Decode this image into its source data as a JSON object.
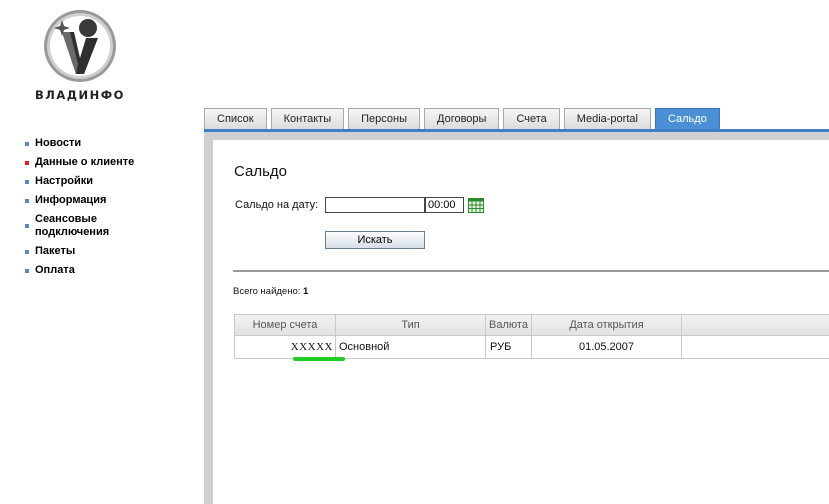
{
  "brand": {
    "name": "ВЛАДИНФО"
  },
  "nav": {
    "items": [
      {
        "label": "Новости",
        "bullet_color": "#5a88c8"
      },
      {
        "label": "Данные о клиенте",
        "bullet_color": "#e02020"
      },
      {
        "label": "Настройки",
        "bullet_color": "#5a88c8"
      },
      {
        "label": "Информация",
        "bullet_color": "#5a88c8"
      },
      {
        "label": "Сеансовые подключения",
        "bullet_color": "#5a88c8"
      },
      {
        "label": "Пакеты",
        "bullet_color": "#5a88c8"
      },
      {
        "label": "Оплата",
        "bullet_color": "#5a88c8"
      }
    ]
  },
  "tabs": [
    {
      "label": "Список"
    },
    {
      "label": "Контакты"
    },
    {
      "label": "Персоны"
    },
    {
      "label": "Договоры"
    },
    {
      "label": "Счета"
    },
    {
      "label": "Media-portal"
    },
    {
      "label": "Сальдо",
      "active": true
    }
  ],
  "main": {
    "title": "Сальдо",
    "date_label": "Сальдо на дату:",
    "date_value": "",
    "time_value": "00:00",
    "search_button": "Искать",
    "found_label": "Всего найдено:",
    "found_count": "1"
  },
  "table": {
    "headers": [
      "Номер счета",
      "Тип",
      "Валюта",
      "Дата открытия",
      ""
    ],
    "rows": [
      [
        "XXXXX",
        "Основной",
        "РУБ",
        "01.05.2007",
        ""
      ]
    ]
  },
  "colors": {
    "accent": "#4b8fd6",
    "highlight_underline": "#22cc22"
  }
}
